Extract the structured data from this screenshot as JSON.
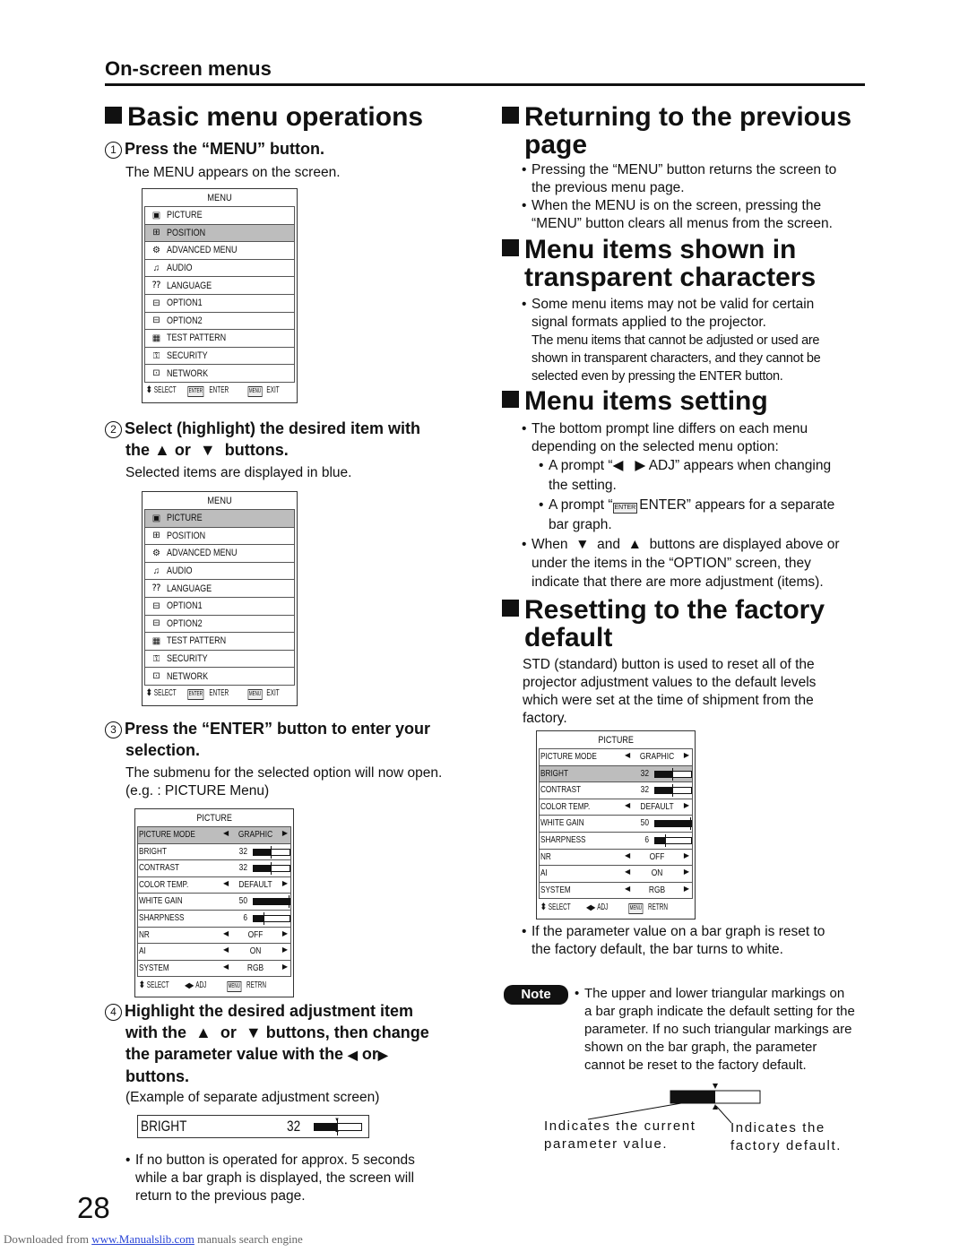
{
  "header": {
    "section": "On-screen menus"
  },
  "left": {
    "title": "Basic menu operations",
    "step1": {
      "num": "1",
      "heading": "Press the “MENU” button.",
      "desc": "The MENU appears on the screen."
    },
    "step2": {
      "num": "2",
      "heading_a": "Select (highlight) the desired item with",
      "heading_b": "the",
      "up": "▲",
      "or": "or",
      "down": "▼",
      "heading_c": "buttons.",
      "desc": "Selected items are displayed in blue."
    },
    "step3": {
      "num": "3",
      "heading_a": "Press the “ENTER” button to enter your",
      "heading_b": "selection.",
      "desc1": "The submenu for the selected option will now open.",
      "desc2": "(e.g. : PICTURE Menu)"
    },
    "step4": {
      "num": "4",
      "line1": "Highlight the desired adjustment item",
      "line2a": "with the",
      "up": "▲",
      "or": "or",
      "down": "▼",
      "line2b": "buttons, then change",
      "line3a": "the parameter value with the",
      "left": "◀",
      "or2": "or",
      "right": "▶",
      "line4": "buttons.",
      "desc": "(Example of separate adjustment screen)"
    },
    "timeout_note": [
      "If no button is operated for approx. 5 seconds",
      "while a bar graph is displayed, the screen will",
      "return to the previous page."
    ]
  },
  "menu_osd_1": {
    "title": "MENU",
    "selected": "POSITION",
    "items": [
      {
        "label": "PICTURE",
        "icon": "picture-icon"
      },
      {
        "label": "POSITION",
        "icon": "position-icon"
      },
      {
        "label": "ADVANCED MENU",
        "icon": "advanced-menu-icon"
      },
      {
        "label": "AUDIO",
        "icon": "audio-icon"
      },
      {
        "label": "LANGUAGE",
        "icon": "language-icon"
      },
      {
        "label": "OPTION1",
        "icon": "option-icon"
      },
      {
        "label": "OPTION2",
        "icon": "option-icon"
      },
      {
        "label": "TEST PATTERN",
        "icon": "test-pattern-icon"
      },
      {
        "label": "SECURITY",
        "icon": "security-icon"
      },
      {
        "label": "NETWORK",
        "icon": "network-icon"
      }
    ],
    "footer": {
      "select": "SELECT",
      "enter_key": "ENTER",
      "enter": "ENTER",
      "menu_key": "MENU",
      "exit": "EXIT"
    }
  },
  "menu_osd_2": {
    "title": "MENU",
    "selected": "PICTURE",
    "items": [
      {
        "label": "PICTURE"
      },
      {
        "label": "POSITION"
      },
      {
        "label": "ADVANCED MENU"
      },
      {
        "label": "AUDIO"
      },
      {
        "label": "LANGUAGE"
      },
      {
        "label": "OPTION1"
      },
      {
        "label": "OPTION2"
      },
      {
        "label": "TEST PATTERN"
      },
      {
        "label": "SECURITY"
      },
      {
        "label": "NETWORK"
      }
    ],
    "footer": {
      "select": "SELECT",
      "enter_key": "ENTER",
      "enter": "ENTER",
      "menu_key": "MENU",
      "exit": "EXIT"
    }
  },
  "picture_osd_1": {
    "title": "PICTURE",
    "selected": "PICTURE MODE",
    "rows": [
      {
        "name": "PICTURE MODE",
        "type": "select",
        "value": "GRAPHIC"
      },
      {
        "name": "BRIGHT",
        "type": "bar",
        "value": "32",
        "level": 0.5,
        "default": 0.5
      },
      {
        "name": "CONTRAST",
        "type": "bar",
        "value": "32",
        "level": 0.5,
        "default": 0.5
      },
      {
        "name": "COLOR TEMP.",
        "type": "select",
        "value": "DEFAULT"
      },
      {
        "name": "WHITE GAIN",
        "type": "bar",
        "value": "50",
        "level": 1.0,
        "default": 1.0
      },
      {
        "name": "SHARPNESS",
        "type": "bar",
        "value": "6",
        "level": 0.3,
        "default": 0.3
      },
      {
        "name": "NR",
        "type": "select",
        "value": "OFF"
      },
      {
        "name": "AI",
        "type": "select",
        "value": "ON"
      },
      {
        "name": "SYSTEM",
        "type": "select",
        "value": "RGB"
      }
    ],
    "footer": {
      "select": "SELECT",
      "adj": "ADJ",
      "menu_key": "MENU",
      "retrn": "RETRN"
    }
  },
  "picture_osd_2": {
    "title": "PICTURE",
    "selected": "BRIGHT",
    "rows": [
      {
        "name": "PICTURE MODE",
        "type": "select",
        "value": "GRAPHIC"
      },
      {
        "name": "BRIGHT",
        "type": "bar",
        "value": "32",
        "level": 0.5,
        "default": 0.5
      },
      {
        "name": "CONTRAST",
        "type": "bar",
        "value": "32",
        "level": 0.5,
        "default": 0.5
      },
      {
        "name": "COLOR TEMP.",
        "type": "select",
        "value": "DEFAULT"
      },
      {
        "name": "WHITE GAIN",
        "type": "bar",
        "value": "50",
        "level": 1.0,
        "default": 1.0
      },
      {
        "name": "SHARPNESS",
        "type": "bar",
        "value": "6",
        "level": 0.3,
        "default": 0.3
      },
      {
        "name": "NR",
        "type": "select",
        "value": "OFF"
      },
      {
        "name": "AI",
        "type": "select",
        "value": "ON"
      },
      {
        "name": "SYSTEM",
        "type": "select",
        "value": "RGB"
      }
    ],
    "footer": {
      "select": "SELECT",
      "adj": "ADJ",
      "menu_key": "MENU",
      "retrn": "RETRN"
    }
  },
  "adjust_screen": {
    "name": "BRIGHT",
    "value": "32",
    "level": 0.5,
    "default": 0.5
  },
  "right": {
    "returning": {
      "title_a": "Returning to the previous",
      "title_b": "page",
      "bullets": [
        [
          "Pressing the “MENU” button returns the screen to",
          "the previous menu page."
        ],
        [
          "When the MENU is on the screen, pressing the",
          "“MENU” button clears all menus from the screen."
        ]
      ]
    },
    "transparent": {
      "title_a": "Menu items shown in",
      "title_b": "transparent characters",
      "bullet": [
        "Some menu items may not be valid for certain",
        "signal formats applied to the projector."
      ],
      "detail": [
        "The menu items that cannot be adjusted or used are",
        "shown in transparent characters, and they cannot be",
        "selected even by pressing the ENTER button."
      ]
    },
    "setting": {
      "title": "Menu items setting",
      "bullet1": [
        "The bottom prompt line differs on each menu",
        "depending on the selected menu option:"
      ],
      "sub1": {
        "a": "A prompt “",
        "left": "◀",
        "right": "▶",
        "b": "ADJ” appears when changing",
        "c": "the setting."
      },
      "sub2": {
        "a": "A prompt “",
        "key": "ENTER",
        "b": "ENTER” appears for a separate",
        "c": "bar graph."
      },
      "bullet2": {
        "a": "When",
        "down": "▼",
        "and": "and",
        "up": "▲",
        "b": "buttons are displayed above or",
        "c": "under the items in the “OPTION” screen, they",
        "d": "indicate that there are more adjustment (items)."
      }
    },
    "reset": {
      "title_a": "Resetting to the factory",
      "title_b": "default",
      "desc": [
        "STD (standard) button is used to reset all of the",
        "projector adjustment values to the default levels",
        "which were set at the time of shipment from the",
        "factory."
      ],
      "bullet": [
        "If the parameter value on a bar graph is reset to",
        "the factory default, the bar turns to white."
      ]
    },
    "note": {
      "badge": "Note",
      "text": [
        "The upper and lower triangular markings on",
        "a bar graph indicate the default setting for the",
        "parameter. If no such triangular markings are",
        "shown on the bar graph, the parameter",
        "cannot be reset to the factory default."
      ],
      "diagram": {
        "level": 0.5,
        "default": 0.5,
        "current_label": [
          "Indicates the current",
          "parameter value."
        ],
        "default_label": [
          "Indicates the",
          "factory default."
        ]
      }
    }
  },
  "page_number": "28",
  "footer": {
    "prefix": "Downloaded from",
    "link": "www.Manualslib.com",
    "suffix": "manuals search engine"
  }
}
